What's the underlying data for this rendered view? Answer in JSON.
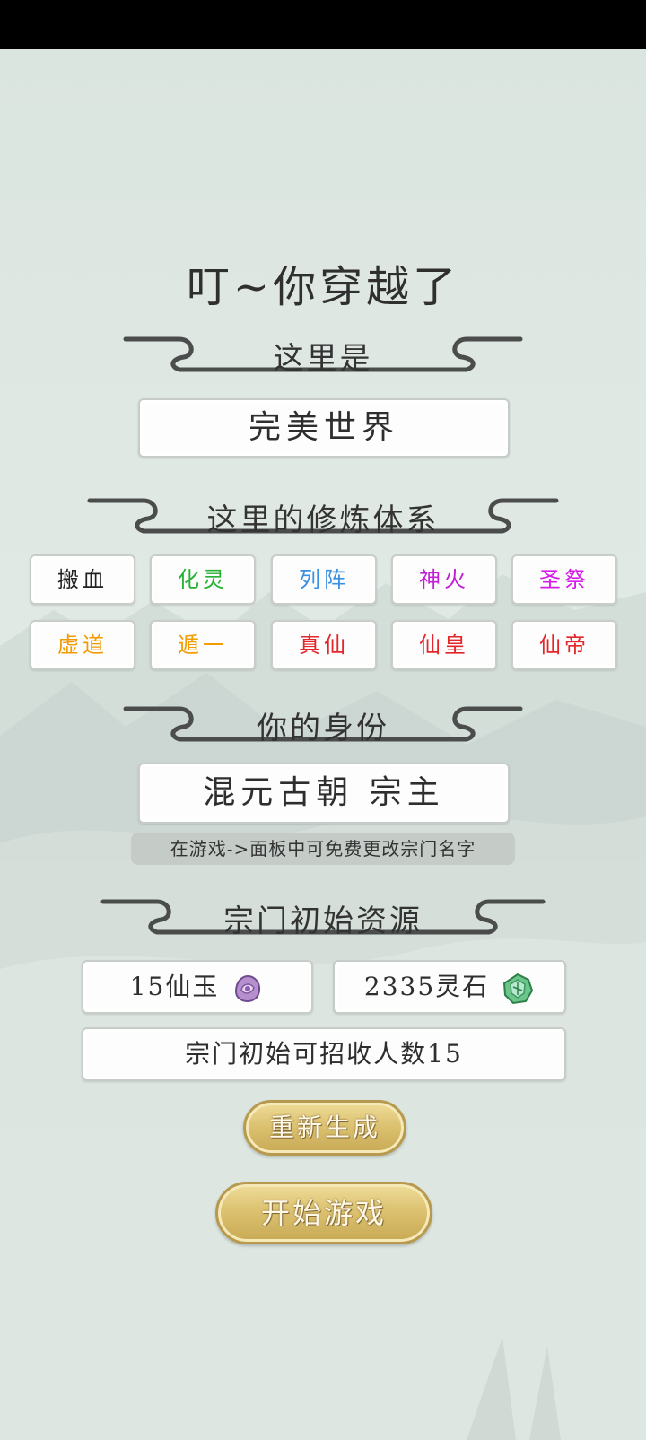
{
  "title": "叮~你穿越了",
  "world": {
    "heading": "这里是",
    "name": "完美世界"
  },
  "cultivation": {
    "heading": "这里的修炼体系",
    "realms": [
      {
        "label": "搬血",
        "color": "#222222"
      },
      {
        "label": "化灵",
        "color": "#27b233"
      },
      {
        "label": "列阵",
        "color": "#3b8fe0"
      },
      {
        "label": "神火",
        "color": "#c21fd6"
      },
      {
        "label": "圣祭",
        "color": "#d41fe6"
      },
      {
        "label": "虚道",
        "color": "#f29a00"
      },
      {
        "label": "遁一",
        "color": "#f39d00"
      },
      {
        "label": "真仙",
        "color": "#e3262a"
      },
      {
        "label": "仙皇",
        "color": "#e3262a"
      },
      {
        "label": "仙帝",
        "color": "#e3262a"
      }
    ]
  },
  "identity": {
    "heading": "你的身份",
    "value": "混元古朝 宗主",
    "hint": "在游戏->面板中可免费更改宗门名字"
  },
  "resources": {
    "heading": "宗门初始资源",
    "jade": "15仙玉",
    "spirit_stones": "2335灵石",
    "recruit": "宗门初始可招收人数15"
  },
  "buttons": {
    "regenerate": "重新生成",
    "start": "开始游戏"
  },
  "icons": {
    "jade": "purple-jade-icon",
    "stone": "green-spirit-stone-icon"
  }
}
